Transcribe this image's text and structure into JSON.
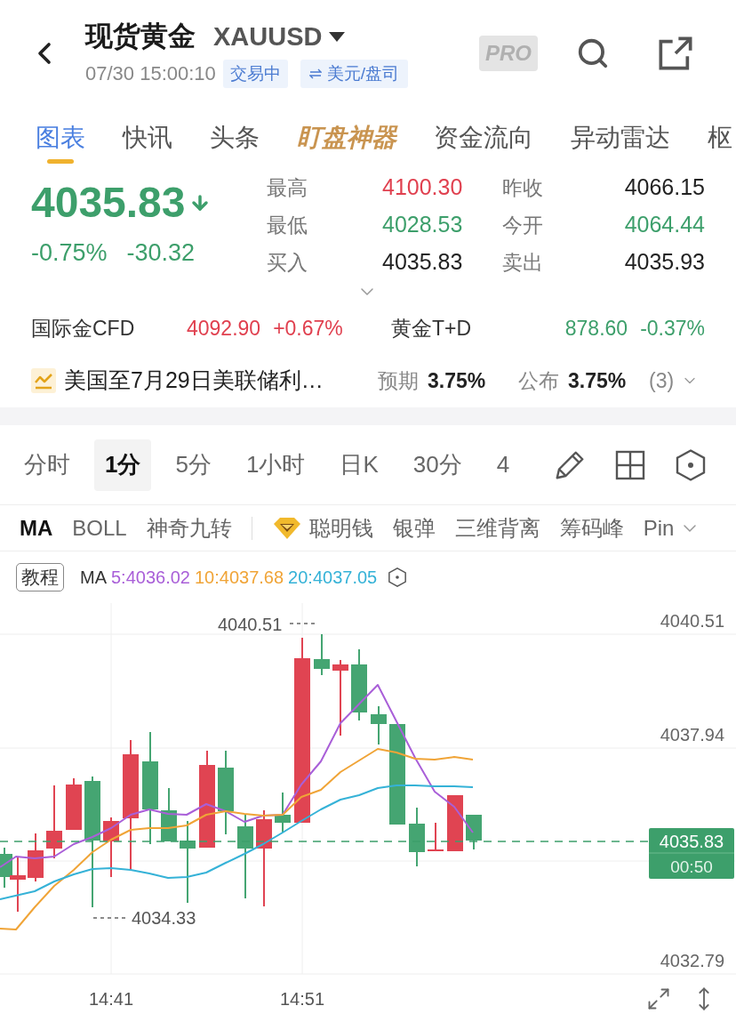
{
  "header": {
    "title": "现货黄金",
    "symbol": "XAUUSD",
    "datetime": "07/30 15:00:10",
    "badges": [
      {
        "kind": "status",
        "label": "交易中"
      },
      {
        "kind": "unit",
        "label": "美元/盘司"
      }
    ],
    "pro_badge": "PRO"
  },
  "tabs": [
    {
      "label": "图表",
      "kind": "plain",
      "selected": true
    },
    {
      "label": "快讯",
      "kind": "plain",
      "selected": false
    },
    {
      "label": "头条",
      "kind": "plain",
      "selected": false
    },
    {
      "label": "盯盘神器",
      "kind": "featured",
      "selected": false
    },
    {
      "label": "资金流向",
      "kind": "plain",
      "selected": false
    },
    {
      "label": "异动雷达",
      "kind": "plain",
      "selected": false
    },
    {
      "label": "枢",
      "kind": "plain",
      "selected": false
    }
  ],
  "quote": {
    "price": "4035.83",
    "falling": true,
    "color": "#3d9f6b",
    "change_pct": "-0.75%",
    "change": "-30.32"
  },
  "stats": [
    {
      "label": "最高",
      "value": "4100.30",
      "color": "#e0404f"
    },
    {
      "label": "昨收",
      "value": "4066.15",
      "color": "#222222"
    },
    {
      "label": "最低",
      "value": "4028.53",
      "color": "#3d9f6b"
    },
    {
      "label": "今开",
      "value": "4064.44",
      "color": "#3d9f6b"
    },
    {
      "label": "买入",
      "value": "4035.83",
      "color": "#222222"
    },
    {
      "label": "卖出",
      "value": "4035.93",
      "color": "#222222"
    }
  ],
  "related": [
    {
      "name": "国际金CFD",
      "price": "4092.90",
      "change": "+0.67%",
      "color": "#e0404f"
    },
    {
      "name": "黄金T+D",
      "price": "878.60",
      "change": "-0.37%",
      "color": "#3d9f6b"
    }
  ],
  "event": {
    "title": "美国至7月29日美联储利…",
    "expected_label": "预期",
    "expected": "3.75%",
    "actual_label": "公布",
    "actual": "3.75%",
    "count": "(3)"
  },
  "periods": [
    {
      "label": "分时",
      "selected": false
    },
    {
      "label": "1分",
      "selected": true
    },
    {
      "label": "5分",
      "selected": false
    },
    {
      "label": "1小时",
      "selected": false
    },
    {
      "label": "日K",
      "selected": false
    },
    {
      "label": "30分",
      "selected": false
    },
    {
      "label": "4",
      "selected": false
    }
  ],
  "indicators": [
    {
      "label": "MA",
      "kind": "main",
      "selected": true
    },
    {
      "label": "BOLL",
      "kind": "main",
      "selected": false
    },
    {
      "label": "神奇九转",
      "kind": "main",
      "selected": false
    },
    {
      "label": "聪明钱",
      "kind": "premium",
      "selected": false
    },
    {
      "label": "银弹",
      "kind": "sub",
      "selected": false
    },
    {
      "label": "三维背离",
      "kind": "sub",
      "selected": false
    },
    {
      "label": "筹码峰",
      "kind": "sub",
      "selected": false
    },
    {
      "label": "Pin",
      "kind": "sub",
      "selected": false
    }
  ],
  "chart": {
    "tutorial_button": "教程",
    "ma_label": "MA",
    "ma_values": [
      {
        "text": "5:4036.02",
        "color": "#a95fd8"
      },
      {
        "text": "10:4037.68",
        "color": "#f0a437"
      },
      {
        "text": "20:4037.05",
        "color": "#35b2d7"
      }
    ],
    "high_marker": "4040.51",
    "low_marker": "4034.33",
    "y_labels": [
      "4040.51",
      "4037.94",
      "4032.79"
    ],
    "price_tag": {
      "price": "4035.83",
      "countdown": "00:50"
    },
    "x_labels": [
      "14:41",
      "14:51"
    ]
  }
}
